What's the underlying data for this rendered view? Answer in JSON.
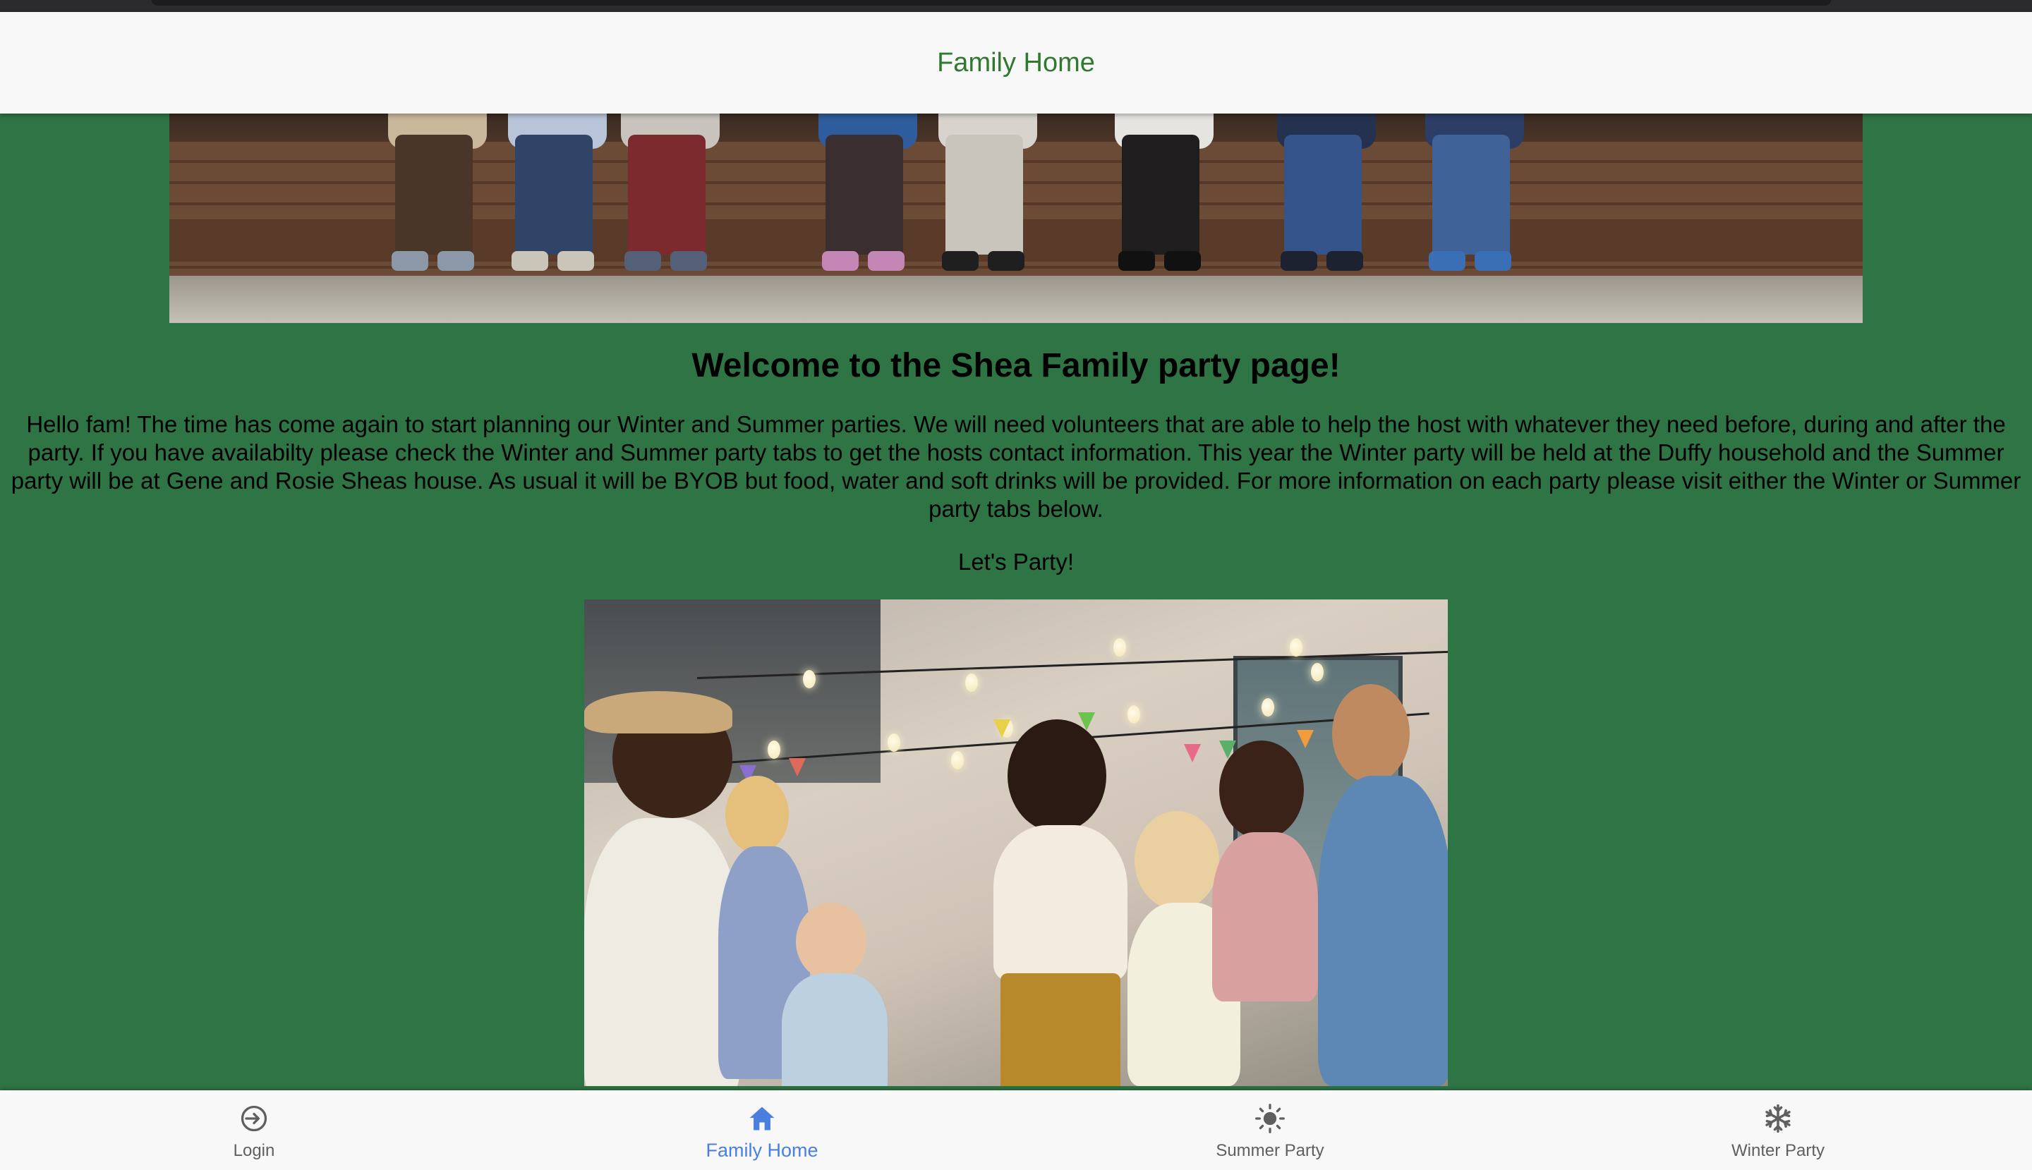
{
  "header": {
    "title": "Family Home"
  },
  "main": {
    "heading": "Welcome to the Shea Family party page!",
    "intro": "Hello fam! The time has come again to start planning our Winter and Summer parties. We will need volunteers that are able to help the host with whatever they need before, during and after the party. If you have availabilty please check the Winter and Summer party tabs to get the hosts contact information. This year the Winter party will be held at the Duffy household and the Summer party will be at Gene and Rosie Sheas house. As usual it will be BYOB but food, water and soft drinks will be provided. For more information on each party please visit either the Winter or Summer party tabs below.",
    "tagline": "Let's Party!"
  },
  "bottom_nav": {
    "items": [
      {
        "label": "Login",
        "icon": "login-icon",
        "active": false
      },
      {
        "label": "Family Home",
        "icon": "home-icon",
        "active": true
      },
      {
        "label": "Summer Party",
        "icon": "sun-icon",
        "active": false
      },
      {
        "label": "Winter Party",
        "icon": "snowflake-icon",
        "active": false
      }
    ]
  },
  "colors": {
    "background": "#2f7444",
    "header_title": "#2f7a2f",
    "nav_active": "#4a7fe0",
    "nav_inactive": "#5f5f5f"
  }
}
